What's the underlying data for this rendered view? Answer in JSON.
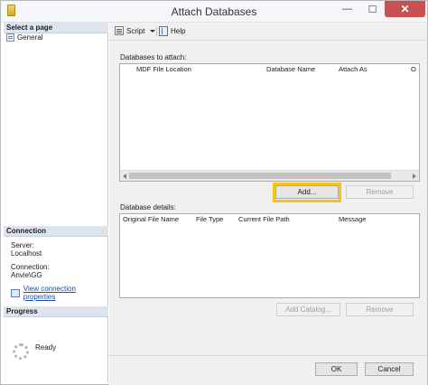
{
  "window": {
    "title": "Attach Databases",
    "minimize": "—",
    "maximize": "☐",
    "close": "✕"
  },
  "left": {
    "select_page_header": "Select a page",
    "pages": [
      {
        "label": "General"
      }
    ],
    "connection_header": "Connection",
    "server_label": "Server:",
    "server_value": "Localhost",
    "connection_label": "Connection:",
    "connection_value": "Anvie\\GG",
    "view_link": "View connection properties",
    "progress_header": "Progress",
    "progress_status": "Ready"
  },
  "toolbar": {
    "script_label": "Script",
    "help_label": "Help"
  },
  "attach": {
    "label": "Databases to attach:",
    "columns": [
      "MDF File Location",
      "Database Name",
      "Attach As",
      "O"
    ],
    "add_label": "Add...",
    "remove_label": "Remove"
  },
  "details": {
    "label": "Database details:",
    "columns": [
      "Original File Name",
      "File Type",
      "Current File Path",
      "Message"
    ],
    "add_catalog_label": "Add Catalog...",
    "remove_label": "Remove"
  },
  "footer": {
    "ok_label": "OK",
    "cancel_label": "Cancel"
  },
  "colors": {
    "highlight": "#f5c518",
    "close_button": "#c75050",
    "link": "#1a4fa3"
  }
}
